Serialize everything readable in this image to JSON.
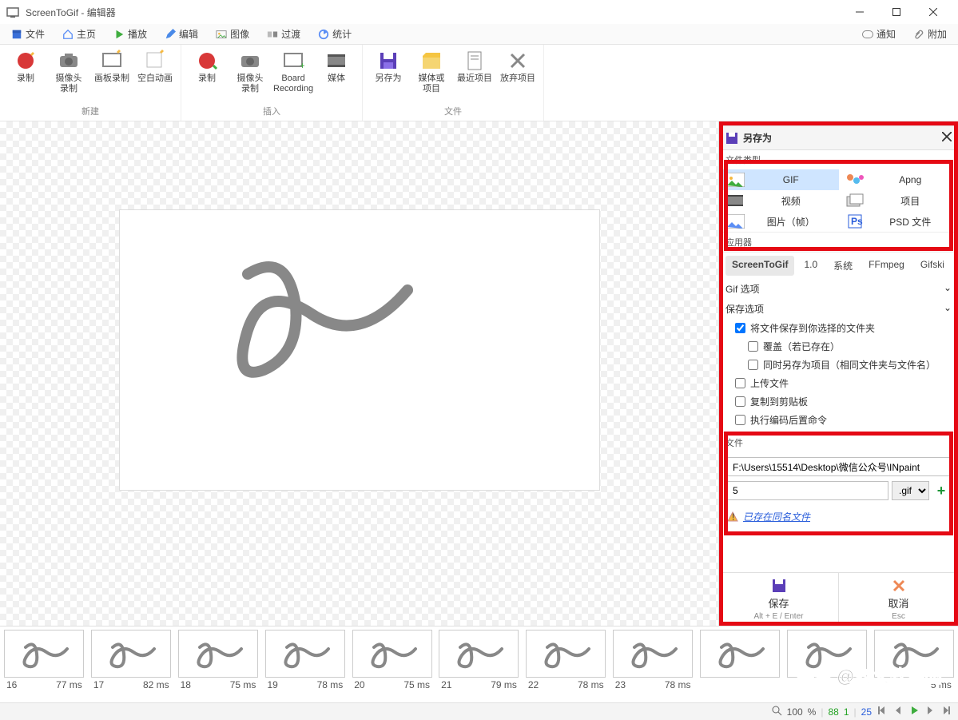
{
  "app": {
    "title": "ScreenToGif - 编辑器"
  },
  "menu": {
    "file": "文件",
    "home": "主页",
    "play": "播放",
    "edit": "编辑",
    "image": "图像",
    "transition": "过渡",
    "stats": "统计",
    "notify": "通知",
    "attach": "附加"
  },
  "ribbon": {
    "group_new": "新建",
    "group_insert": "插入",
    "group_file": "文件",
    "record": "录制",
    "camera_record": "摄像头\n录制",
    "board_record": "画板录制",
    "blank_anim": "空白动画",
    "record2": "录制",
    "camera_record2": "摄像头\n录制",
    "board_recording": "Board\nRecording",
    "media": "媒体",
    "save_as": "另存为",
    "media_project": "媒体或\n项目",
    "recent": "最近项目",
    "discard": "放弃项目"
  },
  "side": {
    "title": "另存为",
    "filetype_header": "文件类型",
    "apps_header": "应用器",
    "gif": "GIF",
    "apng": "Apng",
    "video": "视频",
    "project": "项目",
    "image_frames": "图片（帧）",
    "psd": "PSD 文件",
    "tab_screentogif": "ScreenToGif",
    "tab_10": "1.0",
    "tab_system": "系统",
    "tab_ffmpeg": "FFmpeg",
    "tab_gifski": "Gifski",
    "gif_options": "Gif 选项",
    "save_options": "保存选项",
    "chk_save_folder": "将文件保存到你选择的文件夹",
    "chk_overwrite": "覆盖（若已存在）",
    "chk_save_project": "同时另存为项目（相同文件夹与文件名）",
    "chk_upload": "上传文件",
    "chk_clipboard": "复制到剪贴板",
    "chk_postencode": "执行编码后置命令",
    "file_header": "文件",
    "path": "F:\\Users\\15514\\Desktop\\微信公众号\\INpaint",
    "filename": "5",
    "ext": ".gif",
    "warn_exists": "已存在同名文件",
    "save_btn": "保存",
    "save_hint": "Alt + E / Enter",
    "cancel_btn": "取消",
    "cancel_hint": "Esc"
  },
  "frames": [
    {
      "idx": "16",
      "ms": "77 ms"
    },
    {
      "idx": "17",
      "ms": "82 ms"
    },
    {
      "idx": "18",
      "ms": "75 ms"
    },
    {
      "idx": "19",
      "ms": "78 ms"
    },
    {
      "idx": "20",
      "ms": "75 ms"
    },
    {
      "idx": "21",
      "ms": "79 ms"
    },
    {
      "idx": "22",
      "ms": "78 ms"
    },
    {
      "idx": "23",
      "ms": "78 ms"
    },
    {
      "idx": "",
      "ms": ""
    },
    {
      "idx": "",
      "ms": ""
    },
    {
      "idx": "",
      "ms": "5 ms"
    }
  ],
  "status": {
    "zoom": "100",
    "pct": "%",
    "frames_cur": "88",
    "frames_sel": "1",
    "frames_tot": "25"
  },
  "watermark": "头条 @老大软件园"
}
